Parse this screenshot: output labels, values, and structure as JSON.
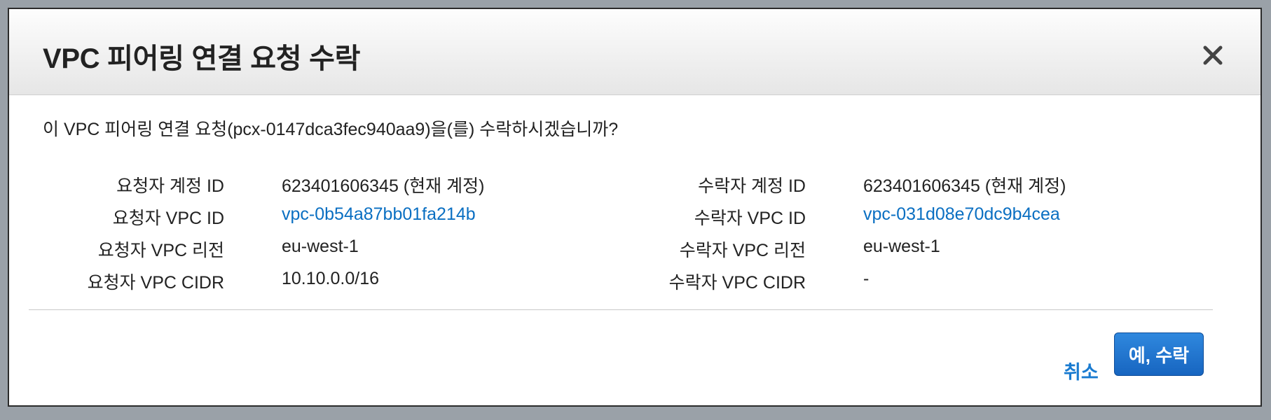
{
  "dialog": {
    "title": "VPC 피어링 연결 요청 수락",
    "close_icon": "close-icon",
    "question": "이 VPC 피어링 연결 요청(pcx-0147dca3fec940aa9)을(를) 수락하시겠습니까?"
  },
  "requester": {
    "account_id_label": "요청자 계정 ID",
    "account_id_value": "623401606345 (현재 계정)",
    "vpc_id_label": "요청자 VPC ID",
    "vpc_id_value": "vpc-0b54a87bb01fa214b",
    "vpc_region_label": "요청자 VPC 리전",
    "vpc_region_value": "eu-west-1",
    "vpc_cidr_label": "요청자 VPC CIDR",
    "vpc_cidr_value": "10.10.0.0/16"
  },
  "accepter": {
    "account_id_label": "수락자 계정 ID",
    "account_id_value": "623401606345 (현재 계정)",
    "vpc_id_label": "수락자 VPC ID",
    "vpc_id_value": "vpc-031d08e70dc9b4cea",
    "vpc_region_label": "수락자 VPC 리전",
    "vpc_region_value": "eu-west-1",
    "vpc_cidr_label": "수락자 VPC CIDR",
    "vpc_cidr_value": "-"
  },
  "footer": {
    "cancel_label": "취소",
    "accept_label": "예, 수락"
  },
  "colors": {
    "link": "#0a6fc2",
    "primary_button": "#1f74cf"
  }
}
